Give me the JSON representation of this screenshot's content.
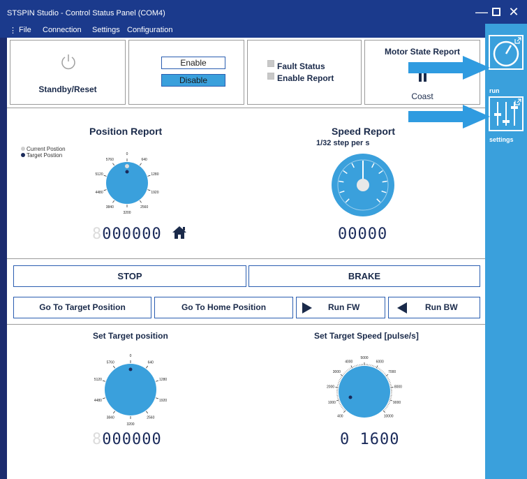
{
  "window": {
    "title": "STSPIN Studio - Control Status Panel (COM4)",
    "minimize_glyph": "—",
    "close_glyph": "✕"
  },
  "menu": {
    "handle": "⋮",
    "items": [
      "File",
      "Connection",
      "Settings",
      "Configuration"
    ]
  },
  "top_row": {
    "standby_label": "Standby/Reset",
    "enable_label": "Enable",
    "disable_label": "Disable",
    "fault_status_label": "Fault Status",
    "enable_report_label": "Enable Report",
    "motor_state_title": "Motor State Report",
    "motor_state_value": "Coast"
  },
  "position_report": {
    "title": "Position Report",
    "legend_current": "Current Postion",
    "legend_target": "Target Postion",
    "dial_ticks": [
      "0",
      "640",
      "1280",
      "1920",
      "2560",
      "3200",
      "3840",
      "4480",
      "5120",
      "5760"
    ],
    "readout_ghost": "8",
    "readout": "000000"
  },
  "speed_report": {
    "title": "Speed Report",
    "subtitle": "1/32 step  per s",
    "readout": "00000"
  },
  "actions": {
    "stop": "STOP",
    "brake": "BRAKE",
    "go_target": "Go To Target Position",
    "go_home": "Go To Home Position",
    "run_fw": "Run FW",
    "run_bw": "Run BW"
  },
  "set_target_position": {
    "title": "Set Target position",
    "dial_ticks": [
      "0",
      "640",
      "1280",
      "1920",
      "2560",
      "3200",
      "3840",
      "4480",
      "5120",
      "5760"
    ],
    "readout_ghost": "8",
    "readout": "000000"
  },
  "set_target_speed": {
    "title": "Set Target Speed [pulse/s]",
    "dial_ticks": [
      "400",
      "1000",
      "2000",
      "3000",
      "4000",
      "5000",
      "6000",
      "7000",
      "8000",
      "9000",
      "10000"
    ],
    "readout": "0 1600"
  },
  "sidebar": {
    "run_label": "run",
    "settings_label": "settings"
  },
  "colors": {
    "accent_blue": "#3aa0dc",
    "title_bar": "#1b3a8c",
    "navy_text": "#1a2a4a",
    "arrow": "#2f9be0"
  }
}
